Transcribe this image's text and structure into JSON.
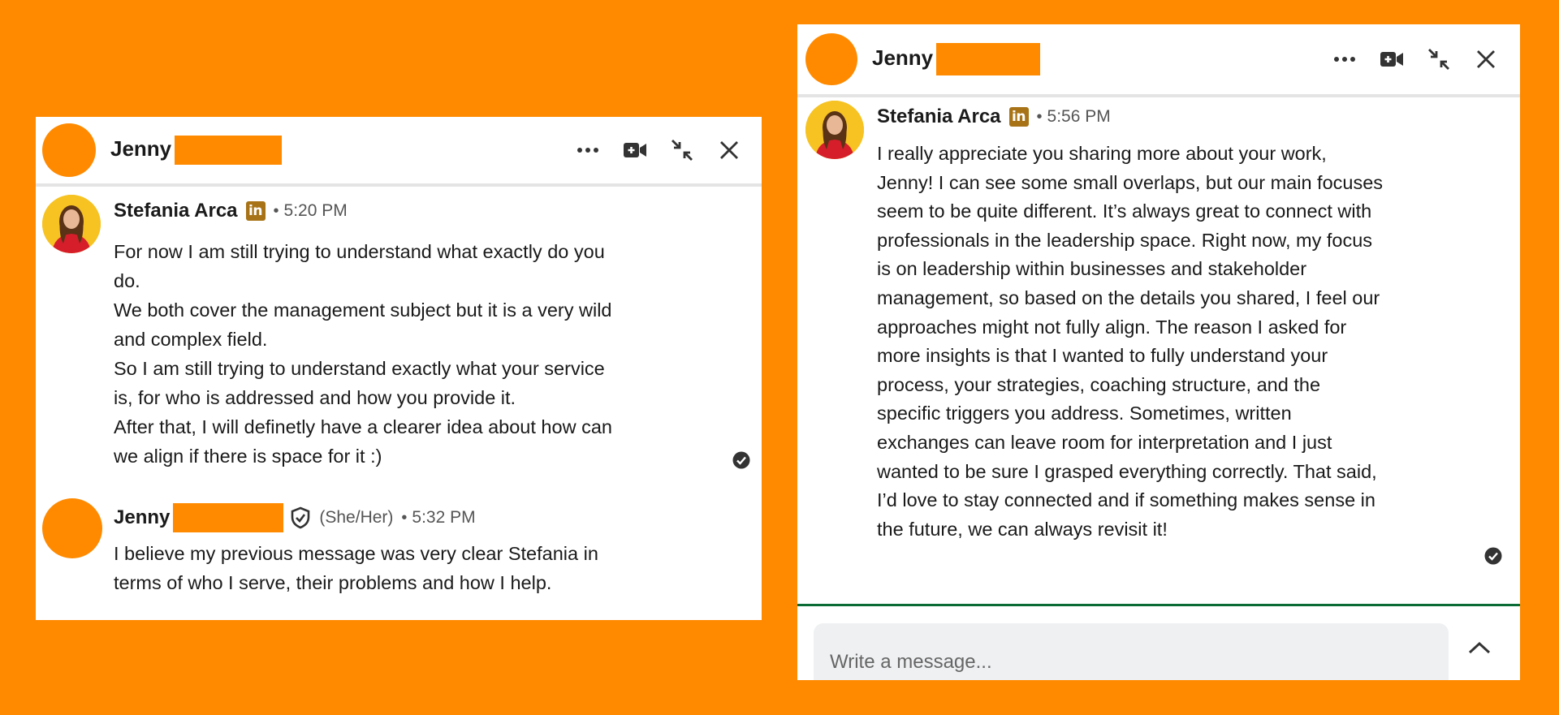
{
  "colors": {
    "background": "#FF8A00",
    "redaction": "#FF8A00",
    "linkedin_badge": "#A87316",
    "composer_focus_line": "#0B6B35"
  },
  "left_panel": {
    "header": {
      "name": "Jenny",
      "actions": [
        "more-icon",
        "video-call-icon",
        "minimize-icon",
        "close-icon"
      ]
    },
    "messages": [
      {
        "sender": "Stefania Arca",
        "badge": "in",
        "dot": "•",
        "time": "5:20 PM",
        "lines": [
          "For now I am still trying to understand what exactly do you",
          "do.",
          "We both cover the management subject but it is a very wild",
          "and complex field.",
          "So I am still trying to understand exactly what your service",
          "is, for who is addressed and how you provide it.",
          "After that, I will definetly have a clearer idea about how can",
          "we align if there is space for it :)"
        ]
      },
      {
        "sender": "Jenny",
        "pronouns": "(She/Her)",
        "dot": "•",
        "time": "5:32 PM",
        "lines": [
          "I believe my previous message was very clear Stefania in",
          "terms of who I serve, their problems and how I help."
        ]
      }
    ]
  },
  "right_panel": {
    "header": {
      "name": "Jenny",
      "actions": [
        "more-icon",
        "video-call-icon",
        "minimize-icon",
        "close-icon"
      ]
    },
    "messages": [
      {
        "sender": "Stefania Arca",
        "badge": "in",
        "dot": "•",
        "time": "5:56 PM",
        "lines": [
          "I really appreciate you sharing more about your work,",
          "Jenny! I can see some small overlaps, but our main focuses",
          "seem to be quite different. It’s always great to connect with",
          "professionals in the leadership space. Right now, my focus",
          "is on leadership within businesses and stakeholder",
          "management, so based on the details you shared, I feel our",
          "approaches might not fully align. The reason I asked for",
          "more insights is that I wanted to fully understand your",
          "process, your strategies, coaching structure, and the",
          "specific triggers you address. Sometimes, written",
          "exchanges can leave room for interpretation and I just",
          "wanted to be sure I grasped everything correctly. That said,",
          "I’d love to stay connected and if something makes sense in",
          "the future, we can always revisit it!"
        ]
      }
    ],
    "composer": {
      "placeholder": "Write a message..."
    }
  }
}
